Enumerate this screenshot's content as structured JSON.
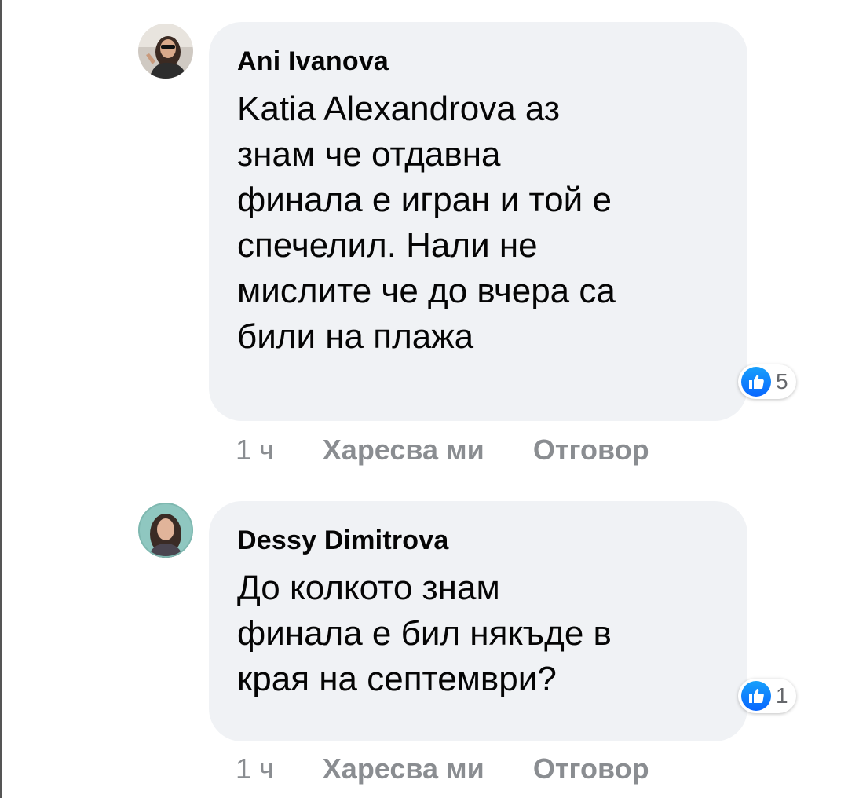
{
  "comments": [
    {
      "author": "Ani Ivanova",
      "avatar_icon": "profile-photo-woman-sunglasses",
      "lines": [
        "Katia Alexandrova  аз",
        "знам че отдавна",
        "финала е игран и той е",
        "спечелил. Нали не",
        "мислите че до вчера са",
        "били на плажа"
      ],
      "reaction_icon": "like-icon",
      "reaction_count": "5",
      "time": "1 ч",
      "like_label": "Харесва ми",
      "reply_label": "Отговор"
    },
    {
      "author": "Dessy Dimitrova",
      "avatar_icon": "profile-photo-woman-long-hair",
      "lines": [
        "До колкото знам",
        "финала е бил някъде в",
        "края на септември?"
      ],
      "reaction_icon": "like-icon",
      "reaction_count": "1",
      "time": "1 ч",
      "like_label": "Харесва ми",
      "reply_label": "Отговор"
    }
  ],
  "colors": {
    "bubble": "#f0f2f5",
    "text": "#050505",
    "meta": "#8a8d91",
    "like_blue": "#0866ff"
  }
}
